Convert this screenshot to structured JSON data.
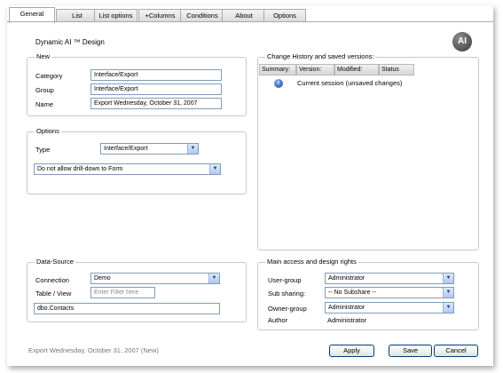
{
  "tabs": [
    "General",
    "List",
    "List options",
    "+Columns",
    "Conditions",
    "About",
    "Options"
  ],
  "title": "Dynamic AI ™ Design",
  "logo_text": "AI",
  "new_group": {
    "legend": "New",
    "category_label": "Category",
    "category_value": "Interface/Export",
    "group_label": "Group",
    "group_value": "Interface/Export",
    "name_label": "Name",
    "name_value": "Export Wednesday, October 31, 2007"
  },
  "options_group": {
    "legend": "Options",
    "type_label": "Type",
    "type_value": "Interface/Export",
    "drilldown_value": "Do not allow drill-down to Form"
  },
  "history": {
    "legend": "Change History and saved versions:",
    "columns": [
      "Summary:",
      "Version:",
      "Modified:",
      "Status"
    ],
    "row_text": "Current session (unsaved changes)",
    "row_icon": "info-icon"
  },
  "datasource": {
    "legend": "Data-Source",
    "connection_label": "Connection",
    "connection_value": "Demo",
    "tableview_label": "Table / View",
    "filter_placeholder": "Enter Filter here",
    "table_value": "dbo.Contacts"
  },
  "access": {
    "legend": "Main access and design rights",
    "usergroup_label": "User-group",
    "usergroup_value": "Administrator",
    "subsharing_label": "Sub sharing:",
    "subsharing_value": "-- No Subshare --",
    "ownergroup_label": "Owner-group",
    "ownergroup_value": "Administrator",
    "author_label": "Author",
    "author_value": "Administrator"
  },
  "footer_text": "Export Wednesday, October 31, 2007 (New)",
  "buttons": {
    "apply": "Apply",
    "save": "Save",
    "cancel": "Cancel"
  }
}
